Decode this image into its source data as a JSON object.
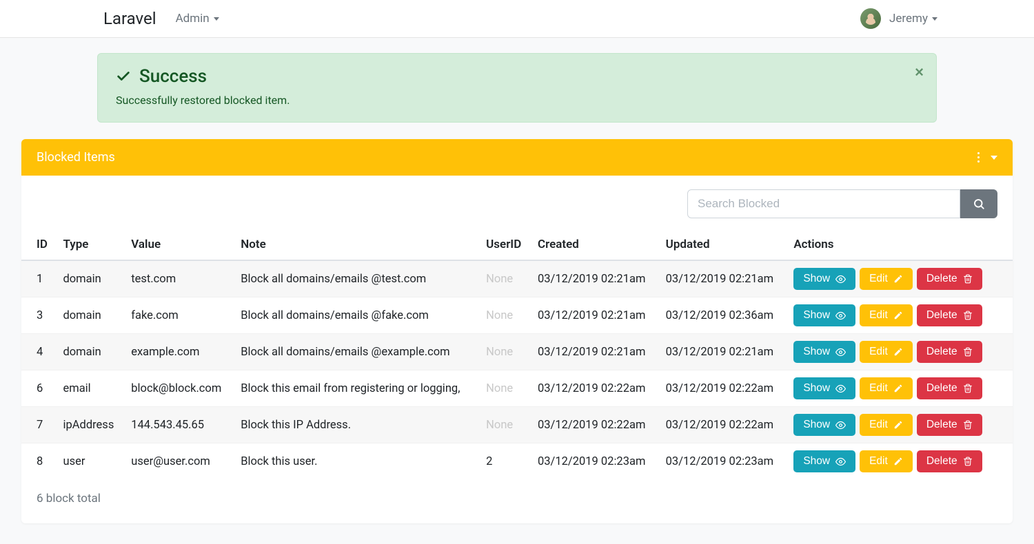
{
  "navbar": {
    "brand": "Laravel",
    "menu": {
      "admin": "Admin"
    },
    "user": {
      "name": "Jeremy"
    }
  },
  "alert": {
    "title": "Success",
    "message": "Successfully restored blocked item."
  },
  "card": {
    "title": "Blocked Items"
  },
  "search": {
    "placeholder": "Search Blocked"
  },
  "table": {
    "headers": {
      "id": "ID",
      "type": "Type",
      "value": "Value",
      "note": "Note",
      "userid": "UserID",
      "created": "Created",
      "updated": "Updated",
      "actions": "Actions"
    },
    "rows": [
      {
        "id": "1",
        "type": "domain",
        "value": "test.com",
        "note": "Block all domains/emails @test.com",
        "userid": "None",
        "userid_muted": true,
        "created": "03/12/2019 02:21am",
        "updated": "03/12/2019 02:21am"
      },
      {
        "id": "3",
        "type": "domain",
        "value": "fake.com",
        "note": "Block all domains/emails @fake.com",
        "userid": "None",
        "userid_muted": true,
        "created": "03/12/2019 02:21am",
        "updated": "03/12/2019 02:36am"
      },
      {
        "id": "4",
        "type": "domain",
        "value": "example.com",
        "note": "Block all domains/emails @example.com",
        "userid": "None",
        "userid_muted": true,
        "created": "03/12/2019 02:21am",
        "updated": "03/12/2019 02:21am"
      },
      {
        "id": "6",
        "type": "email",
        "value": "block@block.com",
        "note": "Block this email from registering or logging,",
        "userid": "None",
        "userid_muted": true,
        "created": "03/12/2019 02:22am",
        "updated": "03/12/2019 02:22am"
      },
      {
        "id": "7",
        "type": "ipAddress",
        "value": "144.543.45.65",
        "note": "Block this IP Address.",
        "userid": "None",
        "userid_muted": true,
        "created": "03/12/2019 02:22am",
        "updated": "03/12/2019 02:22am"
      },
      {
        "id": "8",
        "type": "user",
        "value": "user@user.com",
        "note": "Block this user.",
        "userid": "2",
        "userid_muted": false,
        "created": "03/12/2019 02:23am",
        "updated": "03/12/2019 02:23am"
      }
    ]
  },
  "actions": {
    "show": "Show",
    "edit": "Edit",
    "delete": "Delete"
  },
  "footer": {
    "total": "6 block total"
  }
}
